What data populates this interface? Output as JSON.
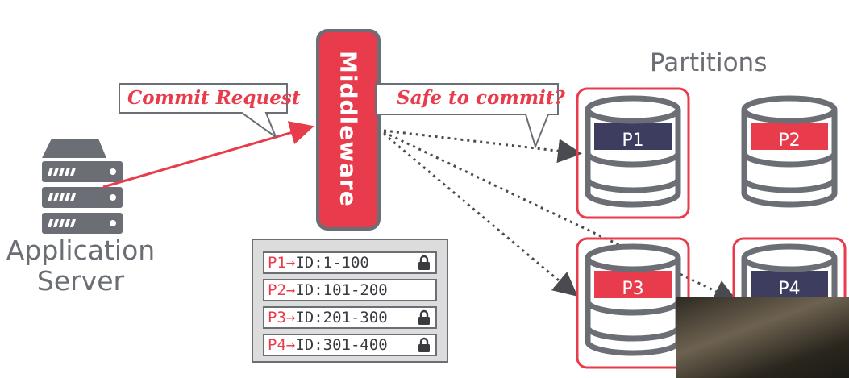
{
  "app_server": {
    "label_line1": "Application",
    "label_line2": "Server",
    "icon": "server-rack-icon"
  },
  "middleware": {
    "label": "Middleware"
  },
  "callouts": {
    "commit_request": "Commit Request",
    "safe_to_commit": "Safe to commit?"
  },
  "partitions": {
    "title": "Partitions",
    "items": [
      {
        "name": "P1",
        "highlighted": true,
        "band_color": "#3d3d60"
      },
      {
        "name": "P2",
        "highlighted": false,
        "band_color": "#e83b4c"
      },
      {
        "name": "P3",
        "highlighted": true,
        "band_color": "#e83b4c"
      },
      {
        "name": "P4",
        "highlighted": true,
        "band_color": "#3d3d60"
      }
    ]
  },
  "routing_table": {
    "rows": [
      {
        "partition": "P1",
        "arrow": "→",
        "range": "ID:1-100",
        "locked": true
      },
      {
        "partition": "P2",
        "arrow": "→",
        "range": "ID:101-200",
        "locked": false
      },
      {
        "partition": "P3",
        "arrow": "→",
        "range": "ID:201-300",
        "locked": true
      },
      {
        "partition": "P4",
        "arrow": "→",
        "range": "ID:301-400",
        "locked": true
      }
    ]
  },
  "colors": {
    "accent": "#e83b4c",
    "gray": "#6b6e74",
    "navy": "#3d3d60"
  }
}
